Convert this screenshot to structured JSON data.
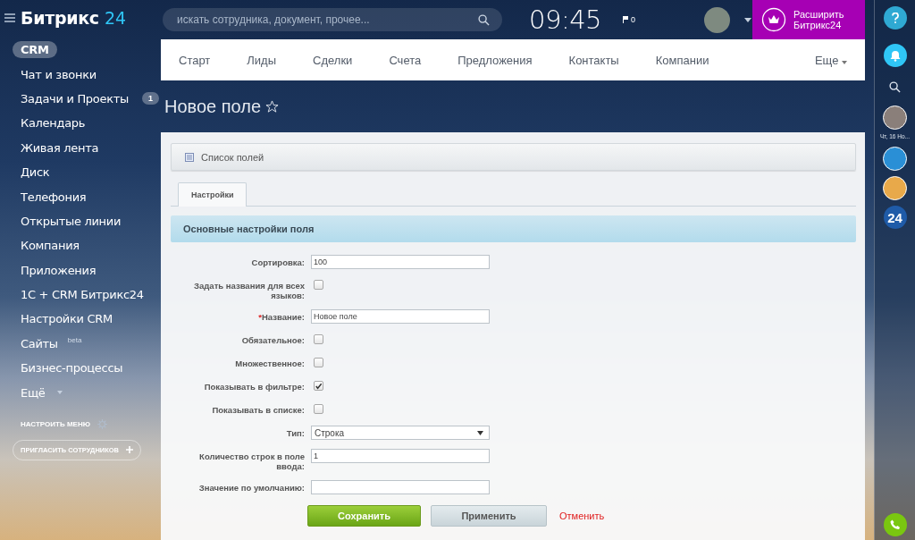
{
  "header": {
    "logo_text": "Битрикс",
    "logo_number": "24",
    "search": {
      "placeholder": "искать сотрудника, документ, прочее..."
    },
    "clock": "09:45",
    "flag_count": "0",
    "upgrade_button": "Расширить Битрикс24"
  },
  "sidebar": {
    "items": [
      {
        "label": "CRM",
        "selected": true
      },
      {
        "label": "Чат и звонки",
        "selected": false
      },
      {
        "label": "Задачи и Проекты",
        "badge": "1",
        "selected": false
      },
      {
        "label": "Календарь",
        "selected": false
      },
      {
        "label": "Живая лента",
        "selected": false
      },
      {
        "label": "Диск",
        "selected": false
      },
      {
        "label": "Телефония",
        "selected": false
      },
      {
        "label": "Открытые линии",
        "selected": false
      },
      {
        "label": "Компания",
        "selected": false
      },
      {
        "label": "Приложения",
        "selected": false
      },
      {
        "label": "1С + CRM Битрикс24",
        "selected": false
      },
      {
        "label": "Настройки CRM",
        "selected": false
      },
      {
        "label": "Сайты",
        "tag": "beta",
        "selected": false
      },
      {
        "label": "Бизнес-процессы",
        "selected": false
      },
      {
        "label": "Ещё",
        "dropdown": true,
        "selected": false
      }
    ],
    "configure_menu": "НАСТРОИТЬ МЕНЮ",
    "invite_button": "ПРИГЛАСИТЬ СОТРУДНИКОВ"
  },
  "nav": {
    "items": [
      "Старт",
      "Лиды",
      "Сделки",
      "Счета",
      "Предложения",
      "Контакты",
      "Компании"
    ],
    "more": "Еще"
  },
  "page_title": "Новое поле",
  "fields_list_button": "Список полей",
  "tabs": [
    {
      "label": "Настройки",
      "selected": true
    }
  ],
  "section_title": "Основные настройки поля",
  "form": [
    {
      "kind": "text",
      "label": "Сортировка:",
      "value": "100"
    },
    {
      "kind": "checkbox",
      "label": "Задать названия для всех языков:",
      "checked": false
    },
    {
      "kind": "text",
      "label": "Название:",
      "required_mark": "*",
      "value": "Новое поле"
    },
    {
      "kind": "checkbox",
      "label": "Обязательное:",
      "checked": false
    },
    {
      "kind": "checkbox",
      "label": "Множественное:",
      "checked": false
    },
    {
      "kind": "checkbox",
      "label": "Показывать в фильтре:",
      "checked": true
    },
    {
      "kind": "checkbox",
      "label": "Показывать в списке:",
      "checked": false
    },
    {
      "kind": "select",
      "label": "Тип:",
      "value": "Строка"
    },
    {
      "kind": "text",
      "label": "Количество строк в поле ввода:",
      "value": "1"
    },
    {
      "kind": "text",
      "label": "Значение по умолчанию:"
    }
  ],
  "buttons": [
    {
      "kind": "primary",
      "label": "Сохранить"
    },
    {
      "kind": "secondary",
      "label": "Применить"
    },
    {
      "kind": "link",
      "label": "Отменить"
    }
  ],
  "right_rail": {
    "date_label": "Чт, 16 Но...",
    "logo_badge": "24"
  }
}
